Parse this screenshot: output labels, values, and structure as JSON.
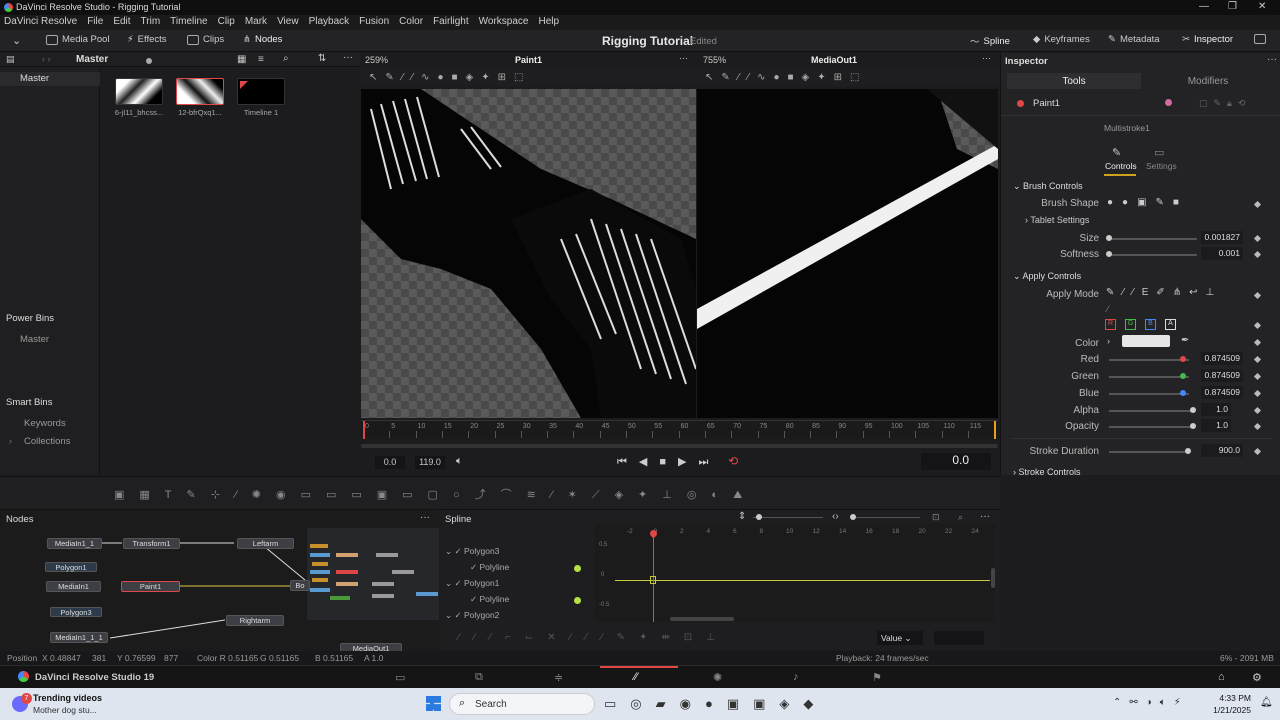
{
  "window": {
    "title": "DaVinci Resolve Studio - Rigging Tutorial",
    "minimize": "—",
    "restore": "❐",
    "close": "✕"
  },
  "menu": [
    "DaVinci Resolve",
    "File",
    "Edit",
    "Trim",
    "Timeline",
    "Clip",
    "Mark",
    "View",
    "Playback",
    "Fusion",
    "Color",
    "Fairlight",
    "Workspace",
    "Help"
  ],
  "toolbar": {
    "media_pool": "Media Pool",
    "effects": "Effects",
    "clips": "Clips",
    "nodes": "Nodes",
    "project_title": "Rigging Tutorial",
    "edited": "Edited",
    "spline": "Spline",
    "keyframes": "Keyframes",
    "metadata": "Metadata",
    "inspector": "Inspector"
  },
  "media": {
    "bin": "Master",
    "zoom_left": "259%",
    "zoom_right": "755%",
    "viewer_left": "Paint1",
    "viewer_right": "MediaOut1",
    "clips": [
      {
        "label": "6-jI11_bhcss..."
      },
      {
        "label": "12-bfrQxq1..."
      },
      {
        "label": "Timeline 1"
      }
    ]
  },
  "bins": {
    "master": "Master",
    "power_bins": "Power Bins",
    "power_master": "Master",
    "smart_bins": "Smart Bins",
    "keywords": "Keywords",
    "collections": "Collections"
  },
  "ruler": {
    "ticks": [
      "0",
      "5",
      "10",
      "15",
      "20",
      "25",
      "30",
      "35",
      "40",
      "45",
      "50",
      "55",
      "60",
      "65",
      "70",
      "75",
      "80",
      "85",
      "90",
      "95",
      "100",
      "105",
      "110",
      "115"
    ]
  },
  "transport": {
    "start": "0.0",
    "end": "119.0",
    "current": "0.0"
  },
  "inspector": {
    "title": "Inspector",
    "tab_tools": "Tools",
    "tab_modifiers": "Modifiers",
    "tool_name": "Paint1",
    "tool_type": "Multistroke1",
    "sub_controls": "Controls",
    "sub_settings": "Settings",
    "brush_controls": "Brush Controls",
    "brush_shape": "Brush Shape",
    "tablet_settings": "Tablet Settings",
    "size_label": "Size",
    "size_value": "0.001827",
    "softness_label": "Softness",
    "softness_value": "0.001",
    "apply_controls": "Apply Controls",
    "apply_mode": "Apply Mode",
    "channels": [
      "R",
      "G",
      "B",
      "A"
    ],
    "color_label": "Color",
    "red_label": "Red",
    "red_value": "0.874509",
    "green_label": "Green",
    "green_value": "0.874509",
    "blue_label": "Blue",
    "blue_value": "0.874509",
    "alpha_label": "Alpha",
    "alpha_value": "1.0",
    "opacity_label": "Opacity",
    "opacity_value": "1.0",
    "stroke_duration_label": "Stroke Duration",
    "stroke_duration_value": "900.0",
    "stroke_controls": "Stroke Controls",
    "colors": {
      "swatch": "#e6e6e6",
      "red": "#d44",
      "green": "#4b4",
      "blue": "#48f"
    }
  },
  "nodes": {
    "title": "Nodes",
    "items": [
      "MediaIn1_1",
      "Transform1",
      "Leftarm",
      "Polygon1",
      "MediaIn1",
      "Paint1",
      "Bo",
      "Polygon3",
      "Rightarm",
      "MediaIn1_1_1",
      "MediaOut1"
    ]
  },
  "spline": {
    "title": "Spline",
    "tree": [
      "Polygon3",
      "Polyline",
      "Polygon1",
      "Polyline",
      "Polygon2"
    ],
    "x_ticks": [
      "-2",
      "0",
      "2",
      "4",
      "6",
      "8",
      "10",
      "12",
      "14",
      "16",
      "18",
      "20",
      "22",
      "24"
    ],
    "y_ticks": [
      "0.5",
      "0",
      "-0.5"
    ],
    "value_dropdown": "Value"
  },
  "status": {
    "position": "Position",
    "x": "X 0.48847",
    "xpx": "381",
    "y": "Y 0.76599",
    "ypx": "877",
    "color": "Color R 0.51165",
    "g": "G 0.51165",
    "b": "B 0.51165",
    "a": "A 1.0",
    "playback": "Playback: 24 frames/sec",
    "memory": "6% - 2091 MB"
  },
  "pagebar": {
    "app": "DaVinci Resolve Studio 19"
  },
  "taskbar": {
    "news_title": "Trending videos",
    "news_sub": "Mother dog stu...",
    "badge": "7",
    "search": "Search",
    "time": "4:33 PM",
    "date": "1/21/2025"
  }
}
